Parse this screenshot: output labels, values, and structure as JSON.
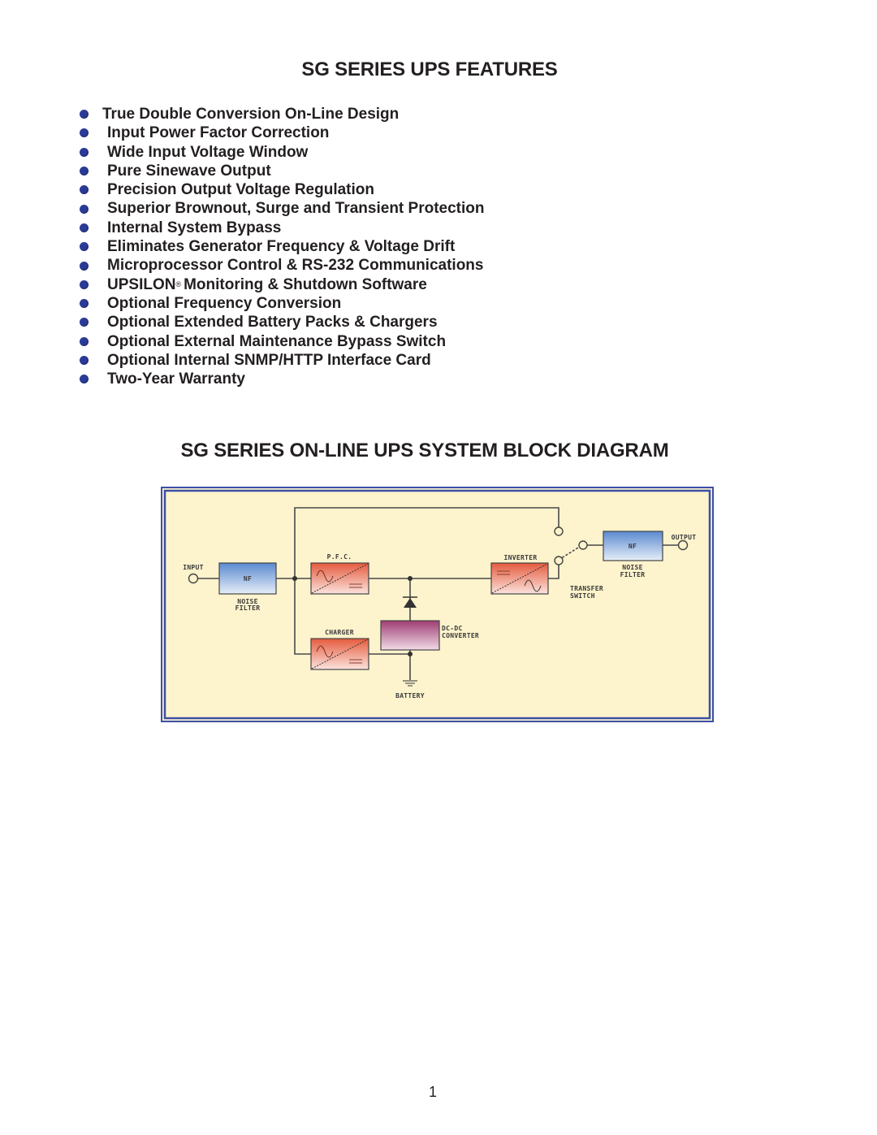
{
  "features_section": {
    "title": "SG SERIES UPS FEATURES",
    "items": [
      {
        "text": "True Double Conversion On-Line Design"
      },
      {
        "text": "Input Power Factor Correction"
      },
      {
        "text": "Wide Input Voltage Window"
      },
      {
        "text": "Pure Sinewave Output"
      },
      {
        "text": "Precision Output Voltage Regulation"
      },
      {
        "text": "Superior Brownout, Surge and Transient Protection"
      },
      {
        "text": "Internal System Bypass"
      },
      {
        "text": "Eliminates Generator Frequency & Voltage Drift"
      },
      {
        "text": "Microprocessor Control & RS-232 Communications"
      },
      {
        "text": "UPSILON",
        "sup": "®",
        "rest": "Monitoring & Shutdown Software"
      },
      {
        "text": "Optional Frequency Conversion"
      },
      {
        "text": "Optional Extended Battery Packs & Chargers"
      },
      {
        "text": "Optional External Maintenance Bypass Switch"
      },
      {
        "text": "Optional Internal SNMP/HTTP Interface Card"
      },
      {
        "text": "Two-Year Warranty"
      }
    ],
    "bullet_color": "#2a3a96"
  },
  "diagram_section": {
    "title": "SG SERIES ON-LINE UPS SYSTEM BLOCK DIAGRAM",
    "labels": {
      "input": "INPUT",
      "input_nf": "NF",
      "input_filter_1": "NOISE",
      "input_filter_2": "FILTER",
      "pfc": "P.F.C.",
      "charger": "CHARGER",
      "dcdc_1": "DC-DC",
      "dcdc_2": "CONVERTER",
      "battery": "BATTERY",
      "inverter": "INVERTER",
      "transfer_1": "TRANSFER",
      "transfer_2": "SWITCH",
      "output_nf": "NF",
      "output_filter_1": "NOISE",
      "output_filter_2": "FILTER",
      "output": "OUTPUT"
    },
    "colors": {
      "frame": "#3b4fa8",
      "background": "#fdf3cc",
      "noise_filter": "#6f9bd6",
      "converter": "#e8664a",
      "dcdc": "#a8457c",
      "wire": "#4a4a4a"
    }
  },
  "page_number": "1"
}
